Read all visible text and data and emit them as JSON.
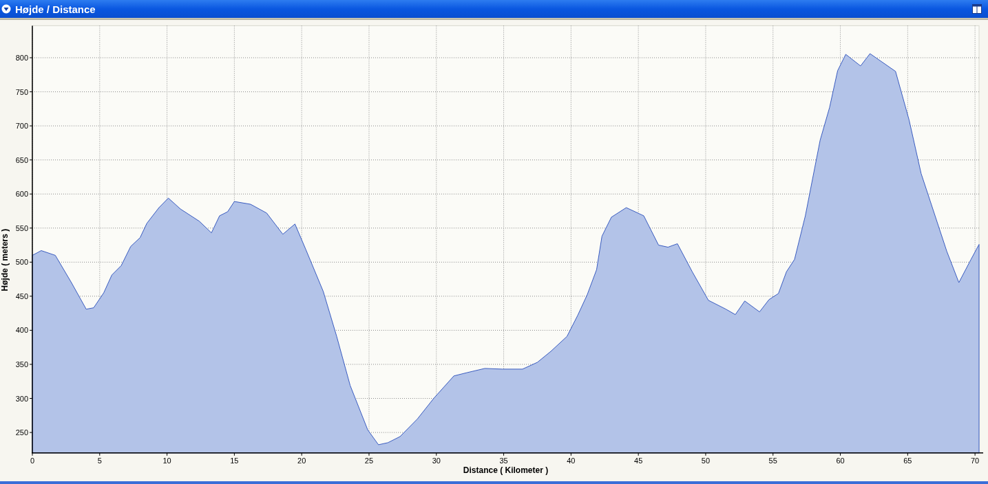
{
  "window": {
    "title": "Højde / Distance"
  },
  "chart": {
    "chart_data": {
      "type": "area",
      "xlabel": "Distance ( Kilometer )",
      "ylabel": "Højde ( meters )",
      "xlim": [
        0,
        70.3
      ],
      "ylim": [
        220,
        847
      ],
      "xticks": [
        0,
        5,
        10,
        15,
        20,
        25,
        30,
        35,
        40,
        45,
        50,
        55,
        60,
        65,
        70
      ],
      "yticks": [
        250,
        300,
        350,
        400,
        450,
        500,
        550,
        600,
        650,
        700,
        750,
        800
      ],
      "x": [
        0,
        0.66,
        1.7,
        2.9,
        4.0,
        4.55,
        5.3,
        5.9,
        6.6,
        7.3,
        8.0,
        8.5,
        9.4,
        10.1,
        11.0,
        12.4,
        13.3,
        13.9,
        14.5,
        15.0,
        16.2,
        17.4,
        18.6,
        19.5,
        20.3,
        21.6,
        22.6,
        23.6,
        24.9,
        25.7,
        26.4,
        27.3,
        28.6,
        29.8,
        31.3,
        32.3,
        33.6,
        34.9,
        36.4,
        37.5,
        38.5,
        39.7,
        40.5,
        41.2,
        41.9,
        42.3,
        43.0,
        44.1,
        45.4,
        46.5,
        47.2,
        47.9,
        49.0,
        50.2,
        51.5,
        52.2,
        52.9,
        54.0,
        54.7,
        55.4,
        56.0,
        56.6,
        57.4,
        58.5,
        59.2,
        59.8,
        60.4,
        61.5,
        62.2,
        64.1,
        65.1,
        66.0,
        67.9,
        68.8,
        69.7,
        70.3
      ],
      "grid": true,
      "series": [
        {
          "color": "#b3c3e8",
          "values": [
            510,
            517,
            510,
            470,
            431,
            433,
            455,
            481,
            495,
            523,
            536,
            557,
            580,
            594,
            578,
            560,
            543,
            568,
            574,
            589,
            585,
            572,
            541,
            556,
            519,
            457,
            391,
            319,
            254,
            232,
            235,
            244,
            270,
            300,
            333,
            338,
            344,
            343,
            343,
            353,
            369,
            391,
            422,
            452,
            489,
            538,
            566,
            580,
            568,
            525,
            522,
            527,
            486,
            444,
            431,
            423,
            443,
            427,
            445,
            454,
            486,
            504,
            568,
            679,
            727,
            781,
            805,
            788,
            806,
            780,
            709,
            630,
            516,
            470,
            504,
            526
          ]
        }
      ]
    }
  }
}
